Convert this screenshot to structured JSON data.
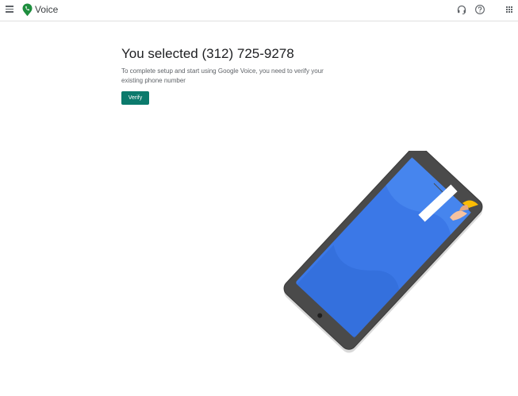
{
  "header": {
    "app_name": "Voice",
    "icons": [
      "menu-icon",
      "voice-logo-icon",
      "headset-icon",
      "help-icon",
      "apps-grid-icon"
    ]
  },
  "main": {
    "headline": "You selected (312) 725-9278",
    "description": "To complete setup and start using Google Voice, you need to verify your existing phone number",
    "verify_label": "Verify"
  },
  "colors": {
    "accent": "#0b7a6c",
    "logo_green": "#1e8e3e",
    "phone_screen": "#3b78e7",
    "phone_frame": "#4a4a4a"
  }
}
